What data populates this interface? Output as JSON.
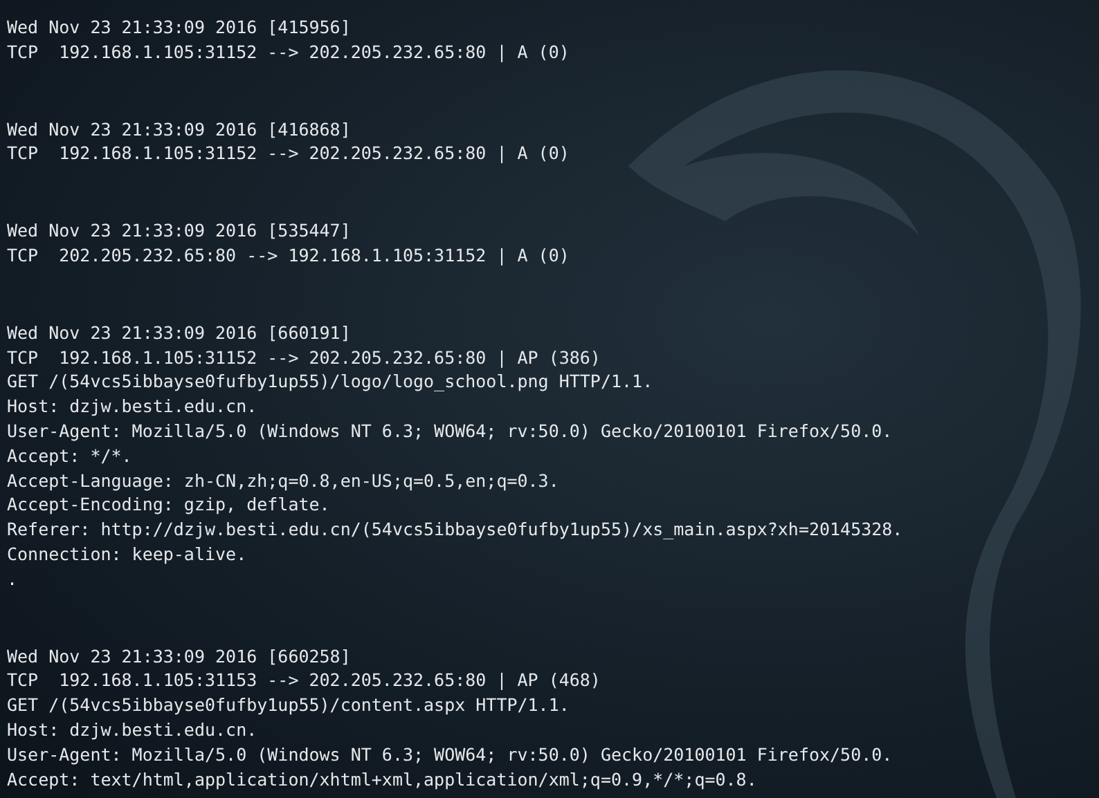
{
  "terminal": {
    "packets": [
      {
        "header": "Wed Nov 23 21:33:09 2016 [415956]",
        "summary": "TCP  192.168.1.105:31152 --> 202.205.232.65:80 | A (0)"
      },
      {
        "header": "Wed Nov 23 21:33:09 2016 [416868]",
        "summary": "TCP  192.168.1.105:31152 --> 202.205.232.65:80 | A (0)"
      },
      {
        "header": "Wed Nov 23 21:33:09 2016 [535447]",
        "summary": "TCP  202.205.232.65:80 --> 192.168.1.105:31152 | A (0)"
      },
      {
        "header": "Wed Nov 23 21:33:09 2016 [660191]",
        "summary": "TCP  192.168.1.105:31152 --> 202.205.232.65:80 | AP (386)",
        "payload": [
          "GET /(54vcs5ibbayse0fufby1up55)/logo/logo_school.png HTTP/1.1.",
          "Host: dzjw.besti.edu.cn.",
          "User-Agent: Mozilla/5.0 (Windows NT 6.3; WOW64; rv:50.0) Gecko/20100101 Firefox/50.0.",
          "Accept: */*.",
          "Accept-Language: zh-CN,zh;q=0.8,en-US;q=0.5,en;q=0.3.",
          "Accept-Encoding: gzip, deflate.",
          "Referer: http://dzjw.besti.edu.cn/(54vcs5ibbayse0fufby1up55)/xs_main.aspx?xh=20145328.",
          "Connection: keep-alive.",
          "."
        ]
      },
      {
        "header": "Wed Nov 23 21:33:09 2016 [660258]",
        "summary": "TCP  192.168.1.105:31153 --> 202.205.232.65:80 | AP (468)",
        "payload": [
          "GET /(54vcs5ibbayse0fufby1up55)/content.aspx HTTP/1.1.",
          "Host: dzjw.besti.edu.cn.",
          "User-Agent: Mozilla/5.0 (Windows NT 6.3; WOW64; rv:50.0) Gecko/20100101 Firefox/50.0.",
          "Accept: text/html,application/xhtml+xml,application/xml;q=0.9,*/*;q=0.8."
        ]
      }
    ]
  }
}
